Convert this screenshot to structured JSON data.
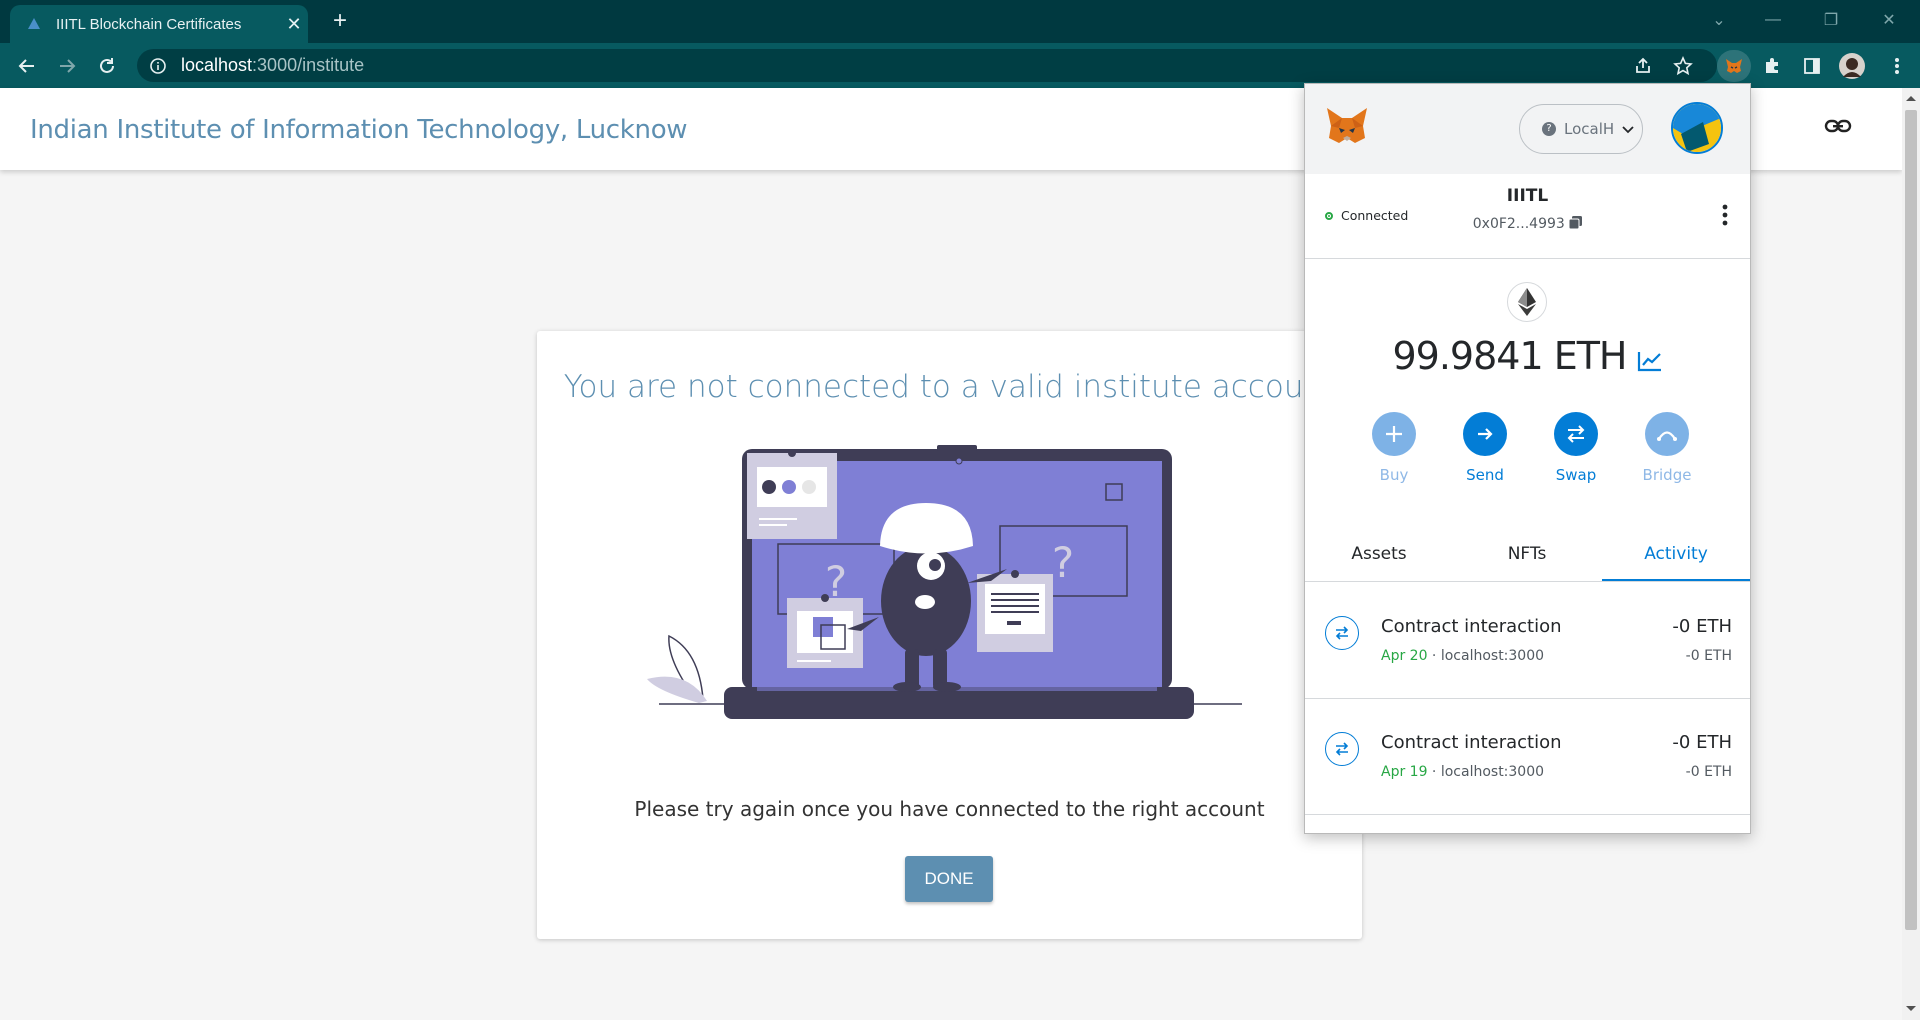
{
  "browser": {
    "tab_title": "IIITL Blockchain Certificates",
    "url_host": "localhost",
    "url_path": ":3000/institute"
  },
  "page": {
    "site_title": "Indian Institute of Information Technology, Lucknow",
    "heading": "You are not connected to a valid institute account",
    "message": "Please try again once you have connected to the right account",
    "done_label": "DONE"
  },
  "metamask": {
    "network_label": "LocalH",
    "status": "Connected",
    "account_name": "IIITL",
    "address": "0x0F2...4993",
    "balance": "99.9841 ETH",
    "actions": [
      {
        "label": "Buy",
        "icon": "plus-icon",
        "color": "#5f9fe0"
      },
      {
        "label": "Send",
        "icon": "arrow-right-icon",
        "color": "#037dd6"
      },
      {
        "label": "Swap",
        "icon": "swap-icon",
        "color": "#037dd6"
      },
      {
        "label": "Bridge",
        "icon": "bridge-icon",
        "color": "#5f9fe0"
      }
    ],
    "tabs": [
      "Assets",
      "NFTs",
      "Activity"
    ],
    "active_tab": "Activity",
    "transactions": [
      {
        "title": "Contract interaction",
        "date": "Apr 20",
        "origin": "localhost:3000",
        "amount": "-0 ETH",
        "sub_amount": "-0 ETH"
      },
      {
        "title": "Contract interaction",
        "date": "Apr 19",
        "origin": "localhost:3000",
        "amount": "-0 ETH",
        "sub_amount": "-0 ETH"
      }
    ]
  },
  "colors": {
    "accent": "#5d8fb1",
    "metamask_blue": "#037dd6",
    "chrome_dark": "#003940",
    "chrome_toolbar": "#075a60"
  }
}
